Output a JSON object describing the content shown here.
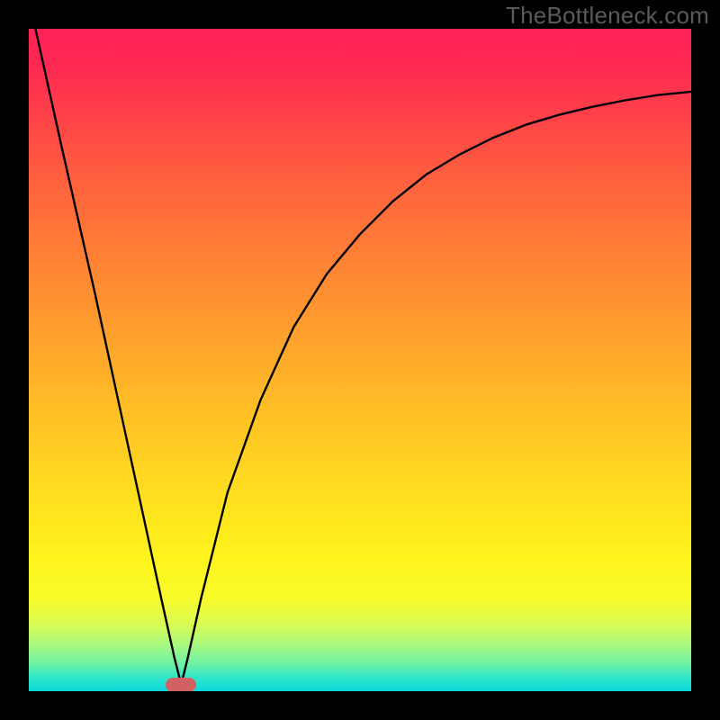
{
  "watermark": "TheBottleneck.com",
  "marker": {
    "x_pct": 23.0,
    "y_pct": 99.0
  },
  "chart_data": {
    "type": "line",
    "title": "",
    "xlabel": "",
    "ylabel": "",
    "xlim": [
      0,
      100
    ],
    "ylim": [
      0,
      100
    ],
    "grid": false,
    "legend": false,
    "series": [
      {
        "name": "curve",
        "x": [
          1,
          5,
          10,
          15,
          20,
          22,
          23,
          24,
          26,
          30,
          35,
          40,
          45,
          50,
          55,
          60,
          65,
          70,
          75,
          80,
          85,
          90,
          95,
          100
        ],
        "y": [
          100,
          82,
          60,
          37,
          14,
          5,
          1,
          5,
          14,
          30,
          44,
          55,
          63,
          69,
          74,
          78,
          81,
          83.5,
          85.5,
          87,
          88.2,
          89.2,
          90,
          90.5
        ]
      }
    ],
    "annotations": [
      {
        "name": "minimum-marker",
        "x": 23,
        "y": 1
      }
    ],
    "background_gradient": {
      "orientation": "vertical",
      "stops": [
        {
          "pos": 0.0,
          "color": "#ff2157"
        },
        {
          "pos": 0.5,
          "color": "#ffb029"
        },
        {
          "pos": 0.8,
          "color": "#fff41d"
        },
        {
          "pos": 1.0,
          "color": "#0fd9db"
        }
      ]
    }
  }
}
